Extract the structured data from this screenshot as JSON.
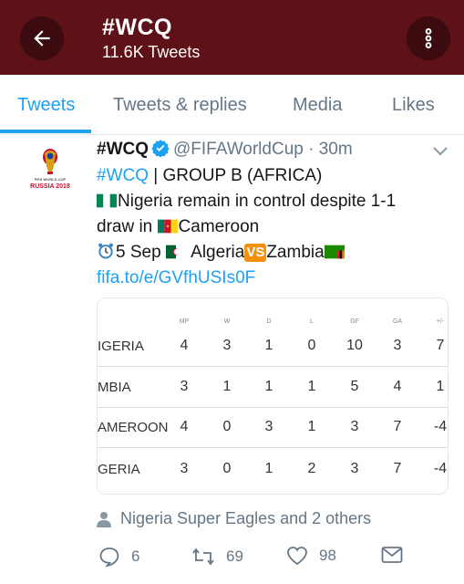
{
  "header": {
    "title": "#WCQ",
    "subtitle": "11.6K Tweets"
  },
  "tabs": [
    {
      "label": "Tweets",
      "active": true
    },
    {
      "label": "Tweets & replies",
      "active": false
    },
    {
      "label": "Media",
      "active": false
    },
    {
      "label": "Likes",
      "active": false
    }
  ],
  "tweet": {
    "avatar_text": "FIFA WORLD CUP RUSSIA 2018",
    "name": "#WCQ",
    "handle": "@FIFAWorldCup",
    "separator": "·",
    "time": "30m",
    "line1_link": "#WCQ",
    "line1_rest": " | GROUP B (AFRICA)",
    "line2": "Nigeria remain in control despite 1-1",
    "line3_a": "draw in ",
    "line3_b": "Cameroon",
    "line4_a": "5 Sep ",
    "line4_b": " Algeria",
    "vs_label": "VS",
    "line4_c": "Zambia",
    "url": "fifa.to/e/GVfhUSIs0F"
  },
  "table": {
    "columns": [
      "MP",
      "W",
      "D",
      "L",
      "GF",
      "GA",
      "+/-"
    ],
    "rows": [
      {
        "team": "IGERIA",
        "cells": [
          "4",
          "3",
          "1",
          "0",
          "10",
          "3",
          "7"
        ]
      },
      {
        "team": "MBIA",
        "cells": [
          "3",
          "1",
          "1",
          "1",
          "5",
          "4",
          "1"
        ]
      },
      {
        "team": "AMEROON",
        "cells": [
          "4",
          "0",
          "3",
          "1",
          "3",
          "7",
          "-4"
        ]
      },
      {
        "team": "GERIA",
        "cells": [
          "3",
          "0",
          "1",
          "2",
          "3",
          "7",
          "-4"
        ]
      }
    ]
  },
  "social_context": "Nigeria Super Eagles and 2 others",
  "actions": {
    "replies": "6",
    "retweets": "69",
    "likes": "98"
  },
  "colors": {
    "header_bg": "#5e1116",
    "accent": "#1da1f2",
    "muted": "#657786"
  }
}
